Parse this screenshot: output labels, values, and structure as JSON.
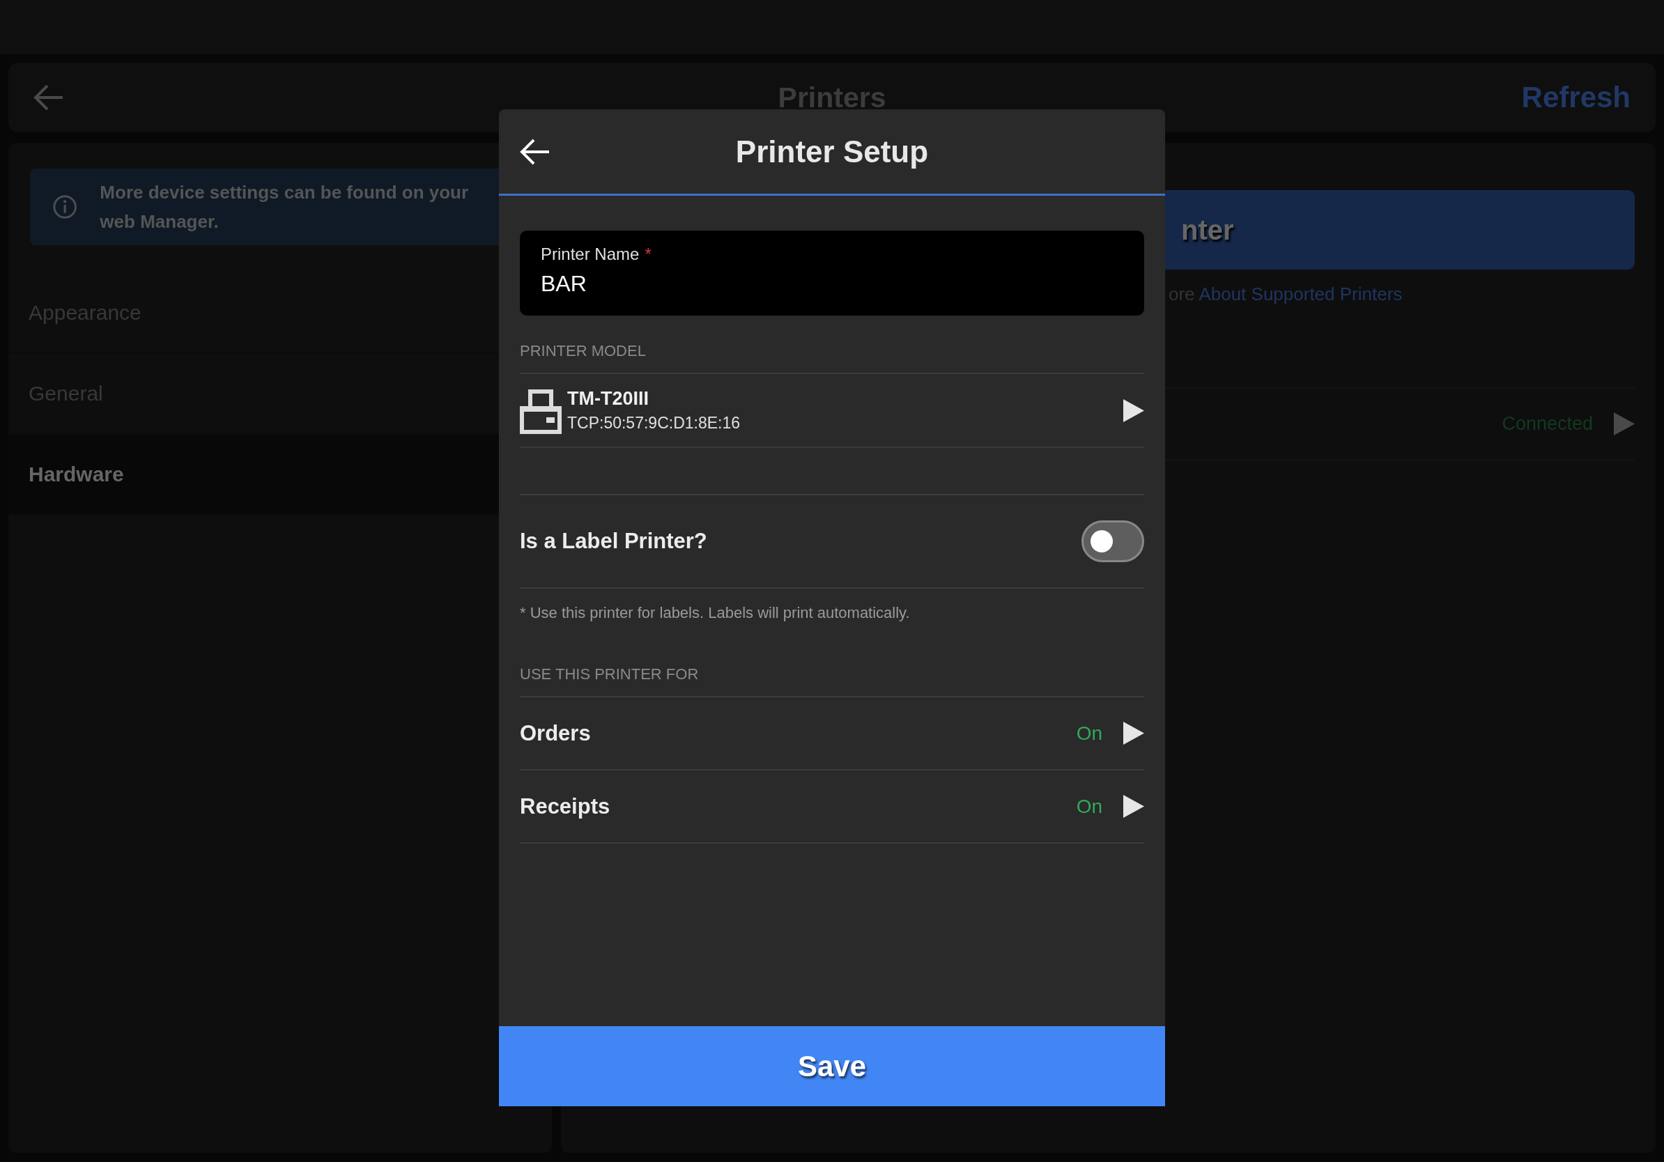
{
  "header": {
    "title": "Printers",
    "action": "Refresh"
  },
  "info_banner": {
    "text": "More device settings can be found on your web Manager."
  },
  "sidebar": {
    "items": [
      {
        "label": "Appearance",
        "selected": false
      },
      {
        "label": "General",
        "selected": false
      },
      {
        "label": "Hardware",
        "selected": true
      }
    ]
  },
  "printers_panel": {
    "add_button": "nter",
    "note": {
      "text": "ore",
      "link": "About Supported Printers"
    },
    "printers": [
      {
        "status": "Connected"
      }
    ]
  },
  "dialog": {
    "title": "Printer Setup",
    "name_field": {
      "label": "Printer Name",
      "required_mark": "*",
      "value": "BAR"
    },
    "model_section": "PRINTER MODEL",
    "model": {
      "name": "TM-T20III",
      "address": "TCP:50:57:9C:D1:8E:16"
    },
    "label_printer": {
      "label": "Is a Label Printer?",
      "on": false
    },
    "label_note": "* Use this printer for labels. Labels will print automatically.",
    "use_section": "USE THIS PRINTER FOR",
    "uses": [
      {
        "label": "Orders",
        "status": "On"
      },
      {
        "label": "Receipts",
        "status": "On"
      }
    ],
    "save": "Save"
  }
}
